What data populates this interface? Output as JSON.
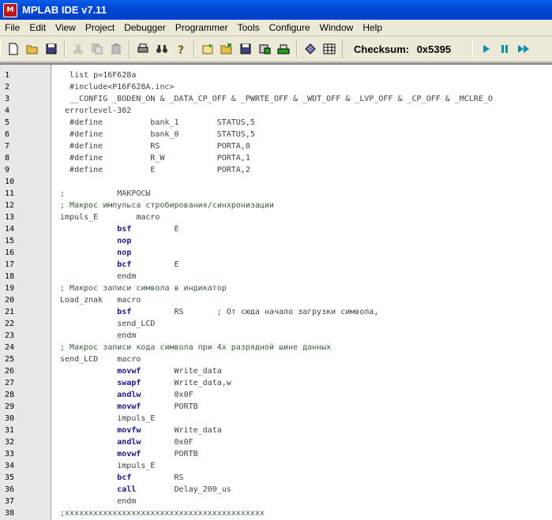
{
  "window": {
    "title": "MPLAB IDE v7.11",
    "icon": "mplab-icon"
  },
  "menu": [
    "File",
    "Edit",
    "View",
    "Project",
    "Debugger",
    "Programmer",
    "Tools",
    "Configure",
    "Window",
    "Help"
  ],
  "toolbar": {
    "checksum_label": "Checksum:",
    "checksum_value": "0x5395"
  },
  "code_lines": [
    {
      "n": "1",
      "segs": [
        {
          "t": "   list p=16F628a",
          "c": ""
        }
      ]
    },
    {
      "n": "2",
      "segs": [
        {
          "t": "   #include<P16F628A.inc>",
          "c": ""
        }
      ]
    },
    {
      "n": "3",
      "segs": [
        {
          "t": "   __CONFIG _BODEN_ON & _DATA_CP_OFF & _PWRTE_OFF & _WDT_OFF & _LVP_OFF & _CP_OFF & _MCLRE_O",
          "c": ""
        }
      ]
    },
    {
      "n": "4",
      "segs": [
        {
          "t": "  errorlevel-302",
          "c": ""
        }
      ]
    },
    {
      "n": "5",
      "segs": [
        {
          "t": "   #define          bank_1        STATUS,5",
          "c": ""
        }
      ]
    },
    {
      "n": "6",
      "segs": [
        {
          "t": "   #define          bank_0        STATUS,5",
          "c": ""
        }
      ]
    },
    {
      "n": "7",
      "segs": [
        {
          "t": "   #define          RS            PORTA,0",
          "c": ""
        }
      ]
    },
    {
      "n": "8",
      "segs": [
        {
          "t": "   #define          R_W           PORTA,1",
          "c": ""
        }
      ]
    },
    {
      "n": "9",
      "segs": [
        {
          "t": "   #define          E             PORTA,2",
          "c": ""
        }
      ]
    },
    {
      "n": "10",
      "segs": [
        {
          "t": "",
          "c": ""
        }
      ]
    },
    {
      "n": "11",
      "segs": [
        {
          "t": " ;           МАКРОСЫ",
          "c": "cm"
        }
      ]
    },
    {
      "n": "12",
      "segs": [
        {
          "t": " ; Макрос импульса стробирования/синхронизации",
          "c": "cm"
        }
      ]
    },
    {
      "n": "13",
      "segs": [
        {
          "t": " impuls_E        macro",
          "c": ""
        }
      ]
    },
    {
      "n": "14",
      "segs": [
        {
          "t": "             ",
          "c": ""
        },
        {
          "t": "bsf",
          "c": "kw"
        },
        {
          "t": "         E",
          "c": ""
        }
      ]
    },
    {
      "n": "15",
      "segs": [
        {
          "t": "             ",
          "c": ""
        },
        {
          "t": "nop",
          "c": "kw"
        }
      ]
    },
    {
      "n": "16",
      "segs": [
        {
          "t": "             ",
          "c": ""
        },
        {
          "t": "nop",
          "c": "kw"
        }
      ]
    },
    {
      "n": "17",
      "segs": [
        {
          "t": "             ",
          "c": ""
        },
        {
          "t": "bcf",
          "c": "kw"
        },
        {
          "t": "         E",
          "c": ""
        }
      ]
    },
    {
      "n": "18",
      "segs": [
        {
          "t": "             endm",
          "c": ""
        }
      ]
    },
    {
      "n": "19",
      "segs": [
        {
          "t": " ; Макрос записи символа в индикатор",
          "c": "cm"
        }
      ]
    },
    {
      "n": "20",
      "segs": [
        {
          "t": " Load_znak   macro",
          "c": ""
        }
      ]
    },
    {
      "n": "21",
      "segs": [
        {
          "t": "             ",
          "c": ""
        },
        {
          "t": "bsf",
          "c": "kw"
        },
        {
          "t": "         RS       ; От сюда начало загрузки символа,",
          "c": ""
        }
      ]
    },
    {
      "n": "22",
      "segs": [
        {
          "t": "             send_LCD",
          "c": ""
        }
      ]
    },
    {
      "n": "23",
      "segs": [
        {
          "t": "             endm",
          "c": ""
        }
      ]
    },
    {
      "n": "24",
      "segs": [
        {
          "t": " ; Макрос записи кода символа при 4х разрядной шине данных",
          "c": "cm"
        }
      ]
    },
    {
      "n": "25",
      "segs": [
        {
          "t": " send_LCD    macro",
          "c": ""
        }
      ]
    },
    {
      "n": "26",
      "segs": [
        {
          "t": "             ",
          "c": ""
        },
        {
          "t": "movwf",
          "c": "kw"
        },
        {
          "t": "       Write_data",
          "c": ""
        }
      ]
    },
    {
      "n": "27",
      "segs": [
        {
          "t": "             ",
          "c": ""
        },
        {
          "t": "swapf",
          "c": "kw"
        },
        {
          "t": "       Write_data,w",
          "c": ""
        }
      ]
    },
    {
      "n": "28",
      "segs": [
        {
          "t": "             ",
          "c": ""
        },
        {
          "t": "andlw",
          "c": "kw"
        },
        {
          "t": "       0x0F",
          "c": ""
        }
      ]
    },
    {
      "n": "29",
      "segs": [
        {
          "t": "             ",
          "c": ""
        },
        {
          "t": "movwf",
          "c": "kw"
        },
        {
          "t": "       PORTB",
          "c": ""
        }
      ]
    },
    {
      "n": "30",
      "segs": [
        {
          "t": "             impuls_E",
          "c": ""
        }
      ]
    },
    {
      "n": "31",
      "segs": [
        {
          "t": "             ",
          "c": ""
        },
        {
          "t": "movfw",
          "c": "kw"
        },
        {
          "t": "       Write_data",
          "c": ""
        }
      ]
    },
    {
      "n": "32",
      "segs": [
        {
          "t": "             ",
          "c": ""
        },
        {
          "t": "andlw",
          "c": "kw"
        },
        {
          "t": "       0x0F",
          "c": ""
        }
      ]
    },
    {
      "n": "33",
      "segs": [
        {
          "t": "             ",
          "c": ""
        },
        {
          "t": "movwf",
          "c": "kw"
        },
        {
          "t": "       PORTB",
          "c": ""
        }
      ]
    },
    {
      "n": "34",
      "segs": [
        {
          "t": "             impuls_E",
          "c": ""
        }
      ]
    },
    {
      "n": "35",
      "segs": [
        {
          "t": "             ",
          "c": ""
        },
        {
          "t": "bcf",
          "c": "kw"
        },
        {
          "t": "         RS",
          "c": ""
        }
      ]
    },
    {
      "n": "36",
      "segs": [
        {
          "t": "             ",
          "c": ""
        },
        {
          "t": "call",
          "c": "kw"
        },
        {
          "t": "        Delay_200_us",
          "c": ""
        }
      ]
    },
    {
      "n": "37",
      "segs": [
        {
          "t": "             endm",
          "c": ""
        }
      ]
    },
    {
      "n": "38",
      "segs": [
        {
          "t": " ;xxxxxxxxxxxxxxxxxxxxxxxxxxxxxxxxxxxxxxxxxx",
          "c": "cm"
        }
      ]
    }
  ]
}
